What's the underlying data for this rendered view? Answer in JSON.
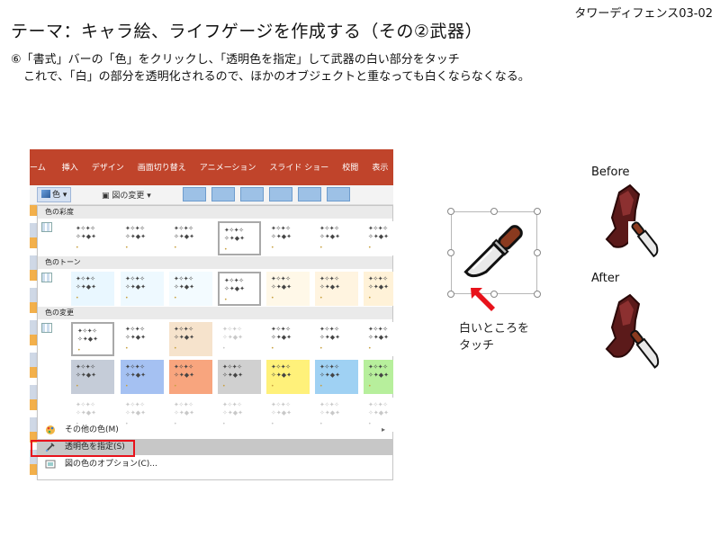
{
  "slide_id": "タワーディフェンス03-02",
  "title": "テーマ：キャラ絵、ライフゲージを作成する（その②武器）",
  "instruction_line1": "⑥「書式」バーの「色」をクリックし、「透明色を指定」して武器の白い部分をタッチ",
  "instruction_line2": "これで、「白」の部分を透明化されるので、ほかのオブジェクトと重なっても白くならなくなる。",
  "ribbon": {
    "tabs": [
      "ーム",
      "挿入",
      "デザイン",
      "画面切り替え",
      "アニメーション",
      "スライド ショー",
      "校閲",
      "表示"
    ],
    "color_button": "色",
    "picture_change": "図の変更"
  },
  "dropdown": {
    "sections": [
      "色の彩度",
      "色のトーン",
      "色の変更"
    ],
    "menu_items": [
      {
        "label": "その他の色(M)",
        "has_submenu": true
      },
      {
        "label": "透明色を指定(S)",
        "highlighted": true
      },
      {
        "label": "図の色のオプション(C)..."
      }
    ]
  },
  "touch_caption_line1": "白いところを",
  "touch_caption_line2": "タッチ",
  "before_label": "Before",
  "after_label": "After",
  "colors": {
    "ribbon": "#c0442b",
    "highlight_box": "#e8121b",
    "arrow": "#e8121b"
  }
}
